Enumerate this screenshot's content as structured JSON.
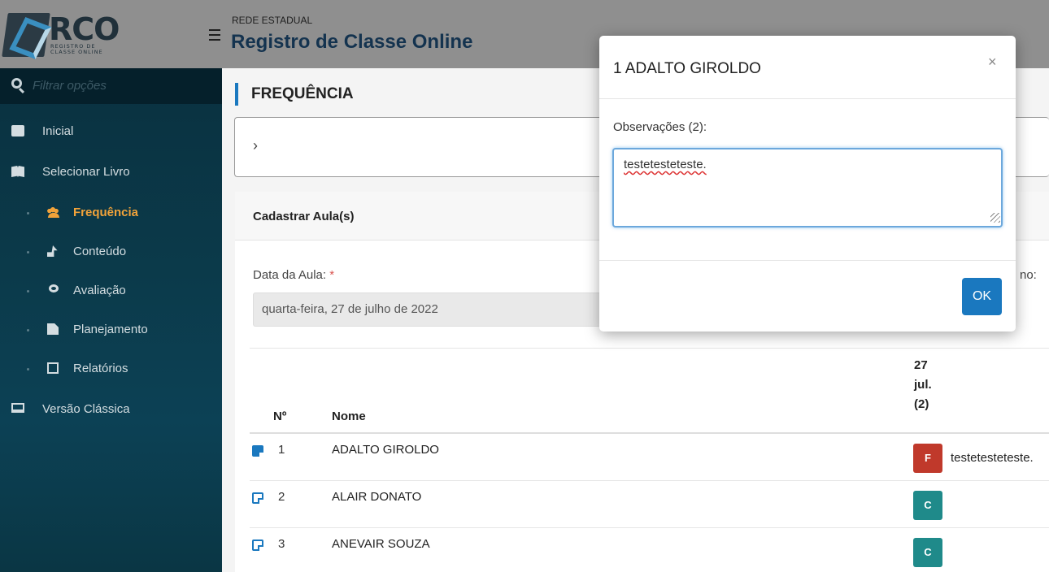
{
  "app": {
    "logo_text": "RCO",
    "logo_subtext": "REGISTRO DE CLASSE ONLINE",
    "header_subtitle": "REDE ESTADUAL",
    "header_title": "Registro de Classe Online"
  },
  "sidebar": {
    "search_placeholder": "Filtrar opções",
    "items": [
      {
        "label": "Inicial"
      },
      {
        "label": "Selecionar Livro"
      },
      {
        "label": "Frequência"
      },
      {
        "label": "Conteúdo"
      },
      {
        "label": "Avaliação"
      },
      {
        "label": "Planejamento"
      },
      {
        "label": "Relatórios"
      },
      {
        "label": "Versão Clássica"
      }
    ]
  },
  "main": {
    "page_title": "FREQUÊNCIA",
    "panel_title": "Cadastrar Aula(s)",
    "date_label": "Data da Aula:",
    "required_mark": "*",
    "date_value": "quarta-feira, 27 de julho de 2022",
    "right_label_fragment": "no:",
    "table": {
      "col_num": "Nº",
      "col_name": "Nome",
      "col_date_day": "27",
      "col_date_month": "jul.",
      "col_date_count": "(2)",
      "rows": [
        {
          "num": "1",
          "name": "ADALTO GIROLDO",
          "status": "F",
          "obs": "testetesteteste."
        },
        {
          "num": "2",
          "name": "ALAIR DONATO",
          "status": "C",
          "obs": ""
        },
        {
          "num": "3",
          "name": "ANEVAIR SOUZA",
          "status": "C",
          "obs": ""
        }
      ]
    }
  },
  "modal": {
    "title": "1 ADALTO GIROLDO",
    "close": "×",
    "obs_label": "Observações (2):",
    "obs_value": "testetesteteste.",
    "ok_label": "OK"
  },
  "colors": {
    "accent": "#1a78bf",
    "active_nav": "#f2a33a",
    "absent_badge": "#c0392b",
    "present_badge": "#1f8a8a"
  }
}
